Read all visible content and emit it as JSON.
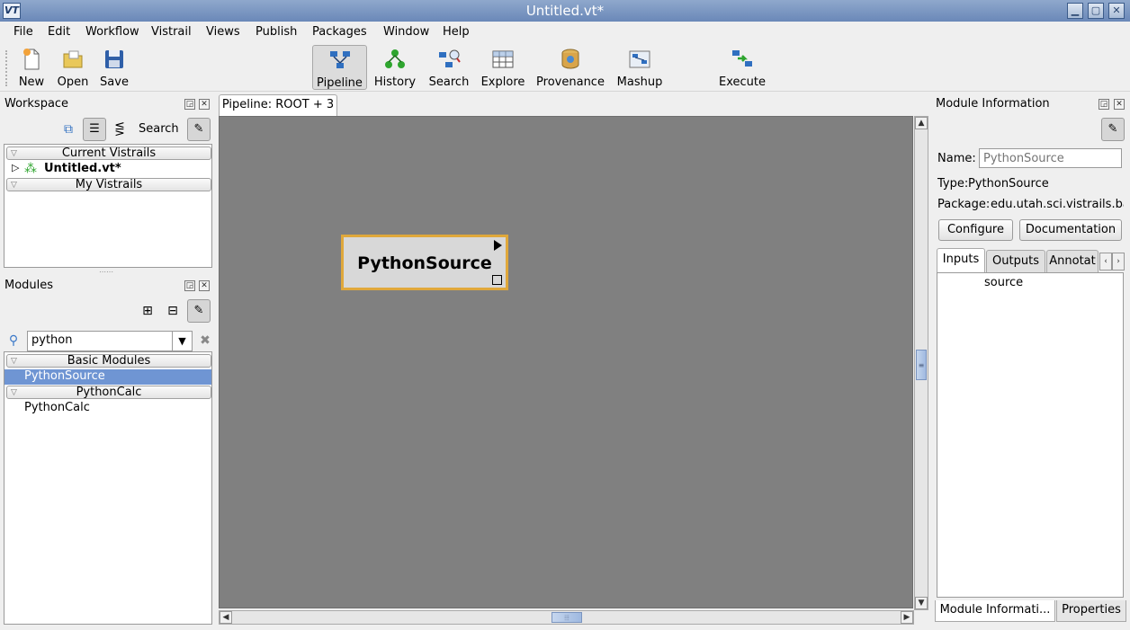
{
  "window": {
    "title": "Untitled.vt*",
    "app_icon": "VT"
  },
  "menu": [
    "File",
    "Edit",
    "Workflow",
    "Vistrail",
    "Views",
    "Publish",
    "Packages",
    "Window",
    "Help"
  ],
  "toolbar": {
    "new": "New",
    "open": "Open",
    "save": "Save",
    "pipeline": "Pipeline",
    "history": "History",
    "search": "Search",
    "explore": "Explore",
    "provenance": "Provenance",
    "mashup": "Mashup",
    "execute": "Execute"
  },
  "workspace": {
    "title": "Workspace",
    "search_label": "Search",
    "groups": [
      "Current Vistrails",
      "My Vistrails"
    ],
    "vistrail_item": "Untitled.vt*"
  },
  "modules": {
    "title": "Modules",
    "search_value": "python",
    "groups": [
      "Basic Modules",
      "PythonCalc"
    ],
    "items": [
      "PythonSource",
      "PythonCalc"
    ]
  },
  "pipeline": {
    "tab_label": "Pipeline: ROOT + 3",
    "module_name": "PythonSource"
  },
  "module_info": {
    "title": "Module Information",
    "name_label": "Name:",
    "name_placeholder": "PythonSource",
    "type_label": "Type:",
    "type_value": "PythonSource",
    "package_label": "Package:",
    "package_value": "edu.utah.sci.vistrails.ba",
    "configure": "Configure",
    "documentation": "Documentation",
    "tabs": [
      "Inputs",
      "Outputs",
      "Annotat"
    ],
    "inputs": [
      "source"
    ],
    "bottom_tabs": [
      "Module Informati...",
      "Properties"
    ]
  },
  "colors": {
    "selection": "#6f95d3",
    "module_border": "#e0a83b",
    "canvas": "#808080"
  },
  "icons": {
    "new": "new-document-icon",
    "open": "folder-icon",
    "save": "floppy-icon",
    "pipeline": "pipeline-icon",
    "history": "tree-icon",
    "search": "search-pipeline-icon",
    "explore": "grid-icon",
    "provenance": "database-icon",
    "mashup": "mashup-icon",
    "execute": "execute-icon"
  }
}
